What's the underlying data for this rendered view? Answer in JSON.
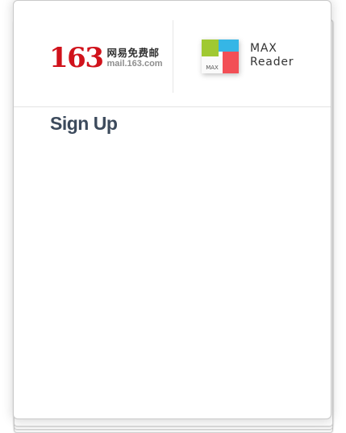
{
  "brand_163": {
    "number": "163",
    "chinese_name": "网易免费邮",
    "domain": "mail.163.com"
  },
  "brand_max": {
    "icon_label": "MAX",
    "name_line1": "MAX",
    "name_line2": "Reader",
    "colors": {
      "green": "#a0c932",
      "blue": "#35b6e6",
      "red": "#f24f56"
    }
  },
  "page": {
    "title": "Sign Up"
  }
}
